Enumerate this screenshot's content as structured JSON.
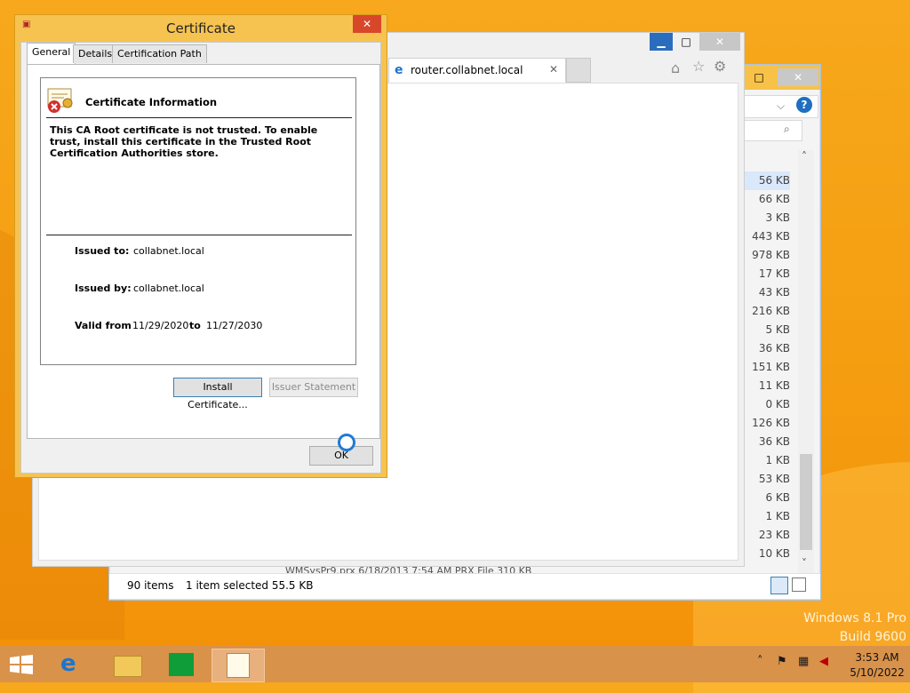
{
  "explorer": {
    "sizes": [
      "56 KB",
      "66 KB",
      "3 KB",
      "443 KB",
      "978 KB",
      "17 KB",
      "43 KB",
      "216 KB",
      "5 KB",
      "36 KB",
      "151 KB",
      "11 KB",
      "0 KB",
      "126 KB",
      "36 KB",
      "1 KB",
      "53 KB",
      "6 KB",
      "1 KB",
      "23 KB",
      "10 KB"
    ],
    "selected_index": 0,
    "partial_row": "WMSysPr9.prx                         6/18/2013 7:54 AM       PRX File             310 KB",
    "status": {
      "items": "90 items",
      "selected": "1 item selected  55.5 KB"
    }
  },
  "ie": {
    "tab_label": "router.collabnet.local"
  },
  "cert": {
    "title": "Certificate",
    "tabs": [
      "General",
      "Details",
      "Certification Path"
    ],
    "info_title": "Certificate Information",
    "message": "This CA Root certificate is not trusted. To enable trust, install this certificate in the Trusted Root Certification Authorities store.",
    "issued_to_label": "Issued to:",
    "issued_to": "collabnet.local",
    "issued_by_label": "Issued by:",
    "issued_by": "collabnet.local",
    "valid_from_label": "Valid from",
    "valid_from": "11/29/2020",
    "to_label": "to",
    "valid_to": "11/27/2030",
    "install_button": "Install Certificate...",
    "issuer_button": "Issuer Statement",
    "ok_button": "OK"
  },
  "taskbar": {
    "clock_time": "3:53 AM",
    "clock_date": "5/10/2022"
  },
  "watermark": {
    "line1": "Windows 8.1 Pro",
    "line2": "Build 9600"
  },
  "colors": {
    "desktop": "#f7a81c",
    "taskbar": "#d9924a",
    "dialog_frame": "#f6c350",
    "close_red": "#d9472b"
  }
}
